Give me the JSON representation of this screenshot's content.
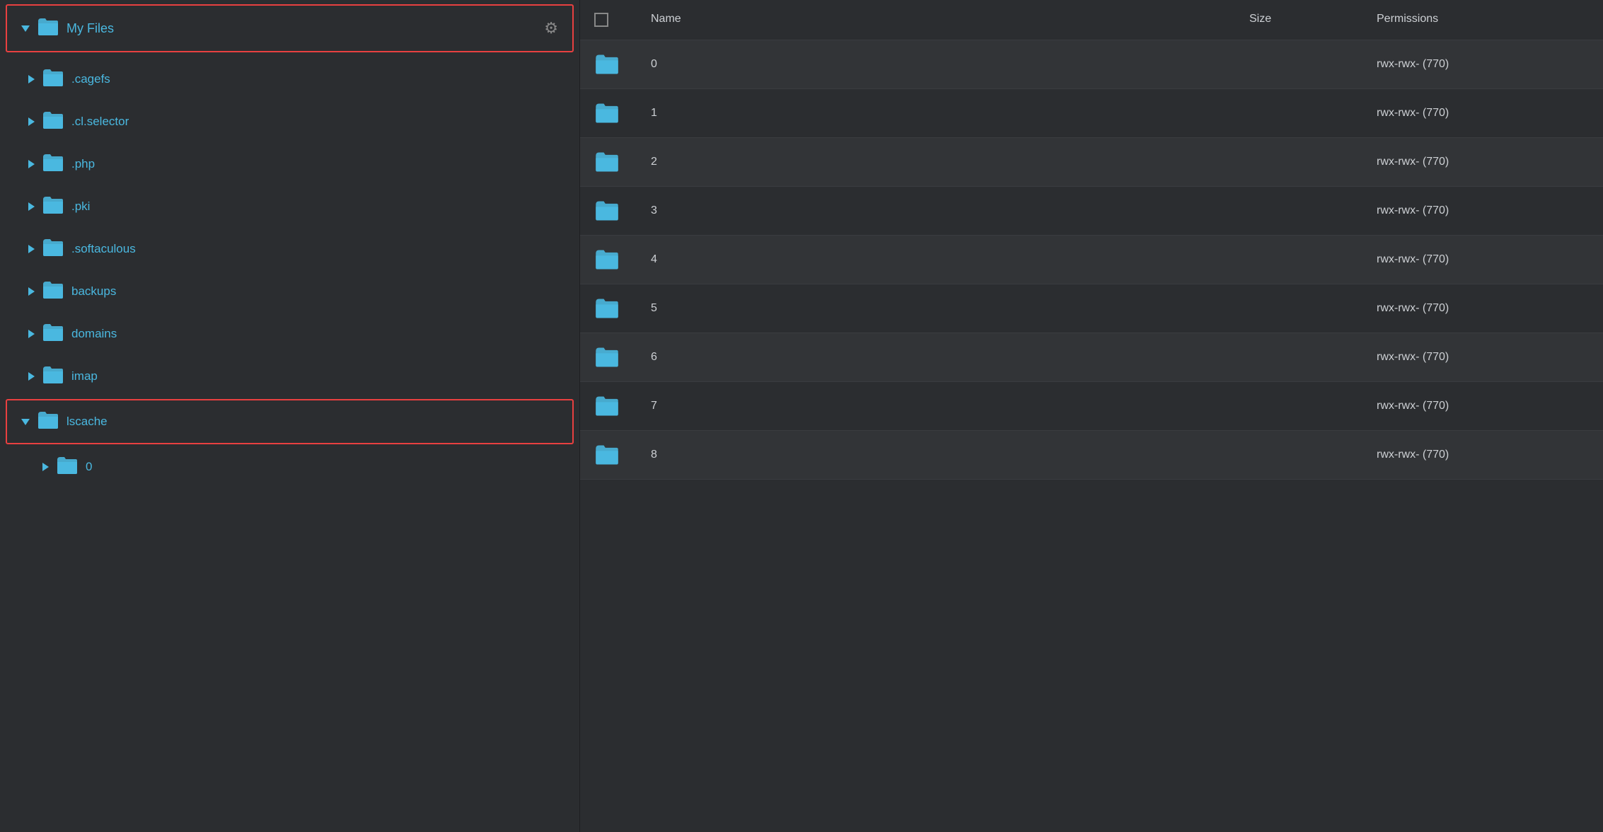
{
  "left_panel": {
    "root": {
      "label": "My Files",
      "expanded": true
    },
    "gear_icon": "⚙",
    "tree_items": [
      {
        "label": ".cagefs"
      },
      {
        "label": ".cl.selector"
      },
      {
        "label": ".php"
      },
      {
        "label": ".pki"
      },
      {
        "label": ".softaculous"
      },
      {
        "label": "backups"
      },
      {
        "label": "domains"
      },
      {
        "label": "imap"
      }
    ],
    "lscache": {
      "label": "lscache",
      "expanded": true
    },
    "lscache_children": [
      {
        "label": "0"
      }
    ]
  },
  "right_panel": {
    "columns": {
      "name": "Name",
      "size": "Size",
      "permissions": "Permissions"
    },
    "rows": [
      {
        "name": "0",
        "size": "",
        "permissions": "rwx-rwx- (770)"
      },
      {
        "name": "1",
        "size": "",
        "permissions": "rwx-rwx- (770)"
      },
      {
        "name": "2",
        "size": "",
        "permissions": "rwx-rwx- (770)"
      },
      {
        "name": "3",
        "size": "",
        "permissions": "rwx-rwx- (770)"
      },
      {
        "name": "4",
        "size": "",
        "permissions": "rwx-rwx- (770)"
      },
      {
        "name": "5",
        "size": "",
        "permissions": "rwx-rwx- (770)"
      },
      {
        "name": "6",
        "size": "",
        "permissions": "rwx-rwx- (770)"
      },
      {
        "name": "7",
        "size": "",
        "permissions": "rwx-rwx- (770)"
      },
      {
        "name": "8",
        "size": "",
        "permissions": "rwx-rwx- (770)"
      }
    ]
  }
}
